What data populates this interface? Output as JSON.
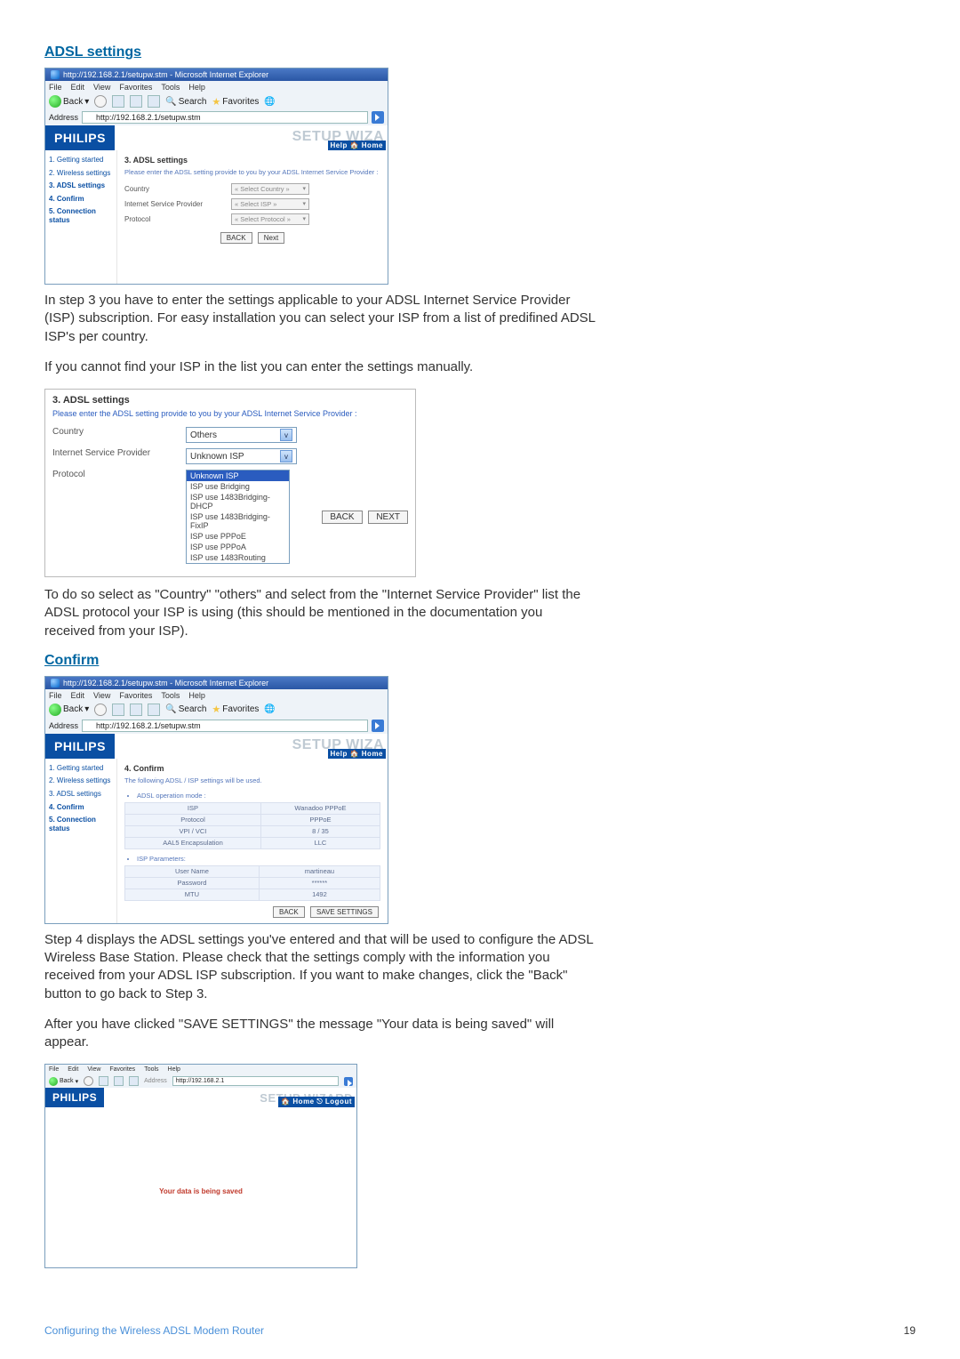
{
  "sections": {
    "adsl_title": "ADSL settings",
    "confirm_title": "Confirm"
  },
  "browser": {
    "titlebar": "http://192.168.2.1/setupw.stm - Microsoft Internet Explorer",
    "menus": [
      "File",
      "Edit",
      "View",
      "Favorites",
      "Tools",
      "Help"
    ],
    "back": "Back",
    "search": "Search",
    "favorites": "Favorites",
    "address_label": "Address",
    "address_value": "http://192.168.2.1/setupw.stm"
  },
  "router_header": {
    "logo": "PHILIPS",
    "wizard": "SETUP WIZA",
    "wizard_full": "SETUP WIZARD",
    "help_home": "Help 🏠 Home",
    "home_logout": "🏠 Home  ⎋ Logout"
  },
  "sidenav": {
    "s1": "1. Getting started",
    "s2": "2. Wireless settings",
    "s3": "3. ADSL settings",
    "s4": "4. Confirm",
    "s5": "5. Connection status"
  },
  "adsl_content": {
    "heading": "3. ADSL settings",
    "intro": "Please enter the ADSL setting provide to you by your ADSL Internet Service Provider :",
    "country": "Country",
    "isp": "Internet Service Provider",
    "protocol": "Protocol",
    "sel_country": "« Select Country »",
    "sel_isp": "« Select ISP »",
    "sel_protocol": "« Select Protocol »",
    "back": "BACK",
    "next": "Next"
  },
  "para1": "In step 3 you have to enter the settings applicable to your ADSL Internet Service Provider (ISP) subscription. For easy installation you can select your ISP from a list of predifined ADSL ISP's per country.",
  "para2": "If you cannot find your ISP in the list you can enter the settings manually.",
  "adsl_panel": {
    "title": "3. ADSL settings",
    "intro": "Please enter the ADSL setting provide to you by your ADSL Internet Service Provider :",
    "country_label": "Country",
    "country_value": "Others",
    "isp_label": "Internet Service Provider",
    "isp_value": "Unknown ISP",
    "protocol_label": "Protocol",
    "options": [
      "Unknown ISP",
      "ISP use Bridging",
      "ISP use 1483Bridging-DHCP",
      "ISP use 1483Bridging-FixIP",
      "ISP use PPPoE",
      "ISP use PPPoA",
      "ISP use 1483Routing"
    ],
    "back": "BACK",
    "next": "NEXT"
  },
  "para3": "To do so select as \"Country\" \"others\" and select from the \"Internet Service Provider\" list the ADSL protocol your ISP is using (this should be mentioned in the documentation you received from your ISP).",
  "confirm_content": {
    "heading": "4. Confirm",
    "intro": "The following ADSL / ISP settings will be used.",
    "bullet1": "ADSL operation mode :",
    "bullet2": "ISP Parameters:",
    "rows1": [
      [
        "ISP",
        "Wanadoo PPPoE"
      ],
      [
        "Protocol",
        "PPPoE"
      ],
      [
        "VPI / VCI",
        "8 / 35"
      ],
      [
        "AAL5 Encapsulation",
        "LLC"
      ]
    ],
    "rows2": [
      [
        "User Name",
        "martineau"
      ],
      [
        "Password",
        "******"
      ],
      [
        "MTU",
        "1492"
      ]
    ],
    "back": "BACK",
    "save": "SAVE SETTINGS"
  },
  "para4": "Step 4 displays the ADSL settings you've entered and that will be used to configure the ADSL Wireless Base Station. Please check that the settings comply with the information you received from your ADSL ISP subscription. If you want to make changes, click the \"Back\" button to go back to Step 3.",
  "para5": "After you have clicked \"SAVE SETTINGS\" the message \"Your data is being saved\" will appear.",
  "saving": {
    "address_value": "http://192.168.2.1",
    "message": "Your data is being saved"
  },
  "footer": {
    "left": "Configuring the Wireless ADSL Modem Router",
    "page": "19"
  }
}
